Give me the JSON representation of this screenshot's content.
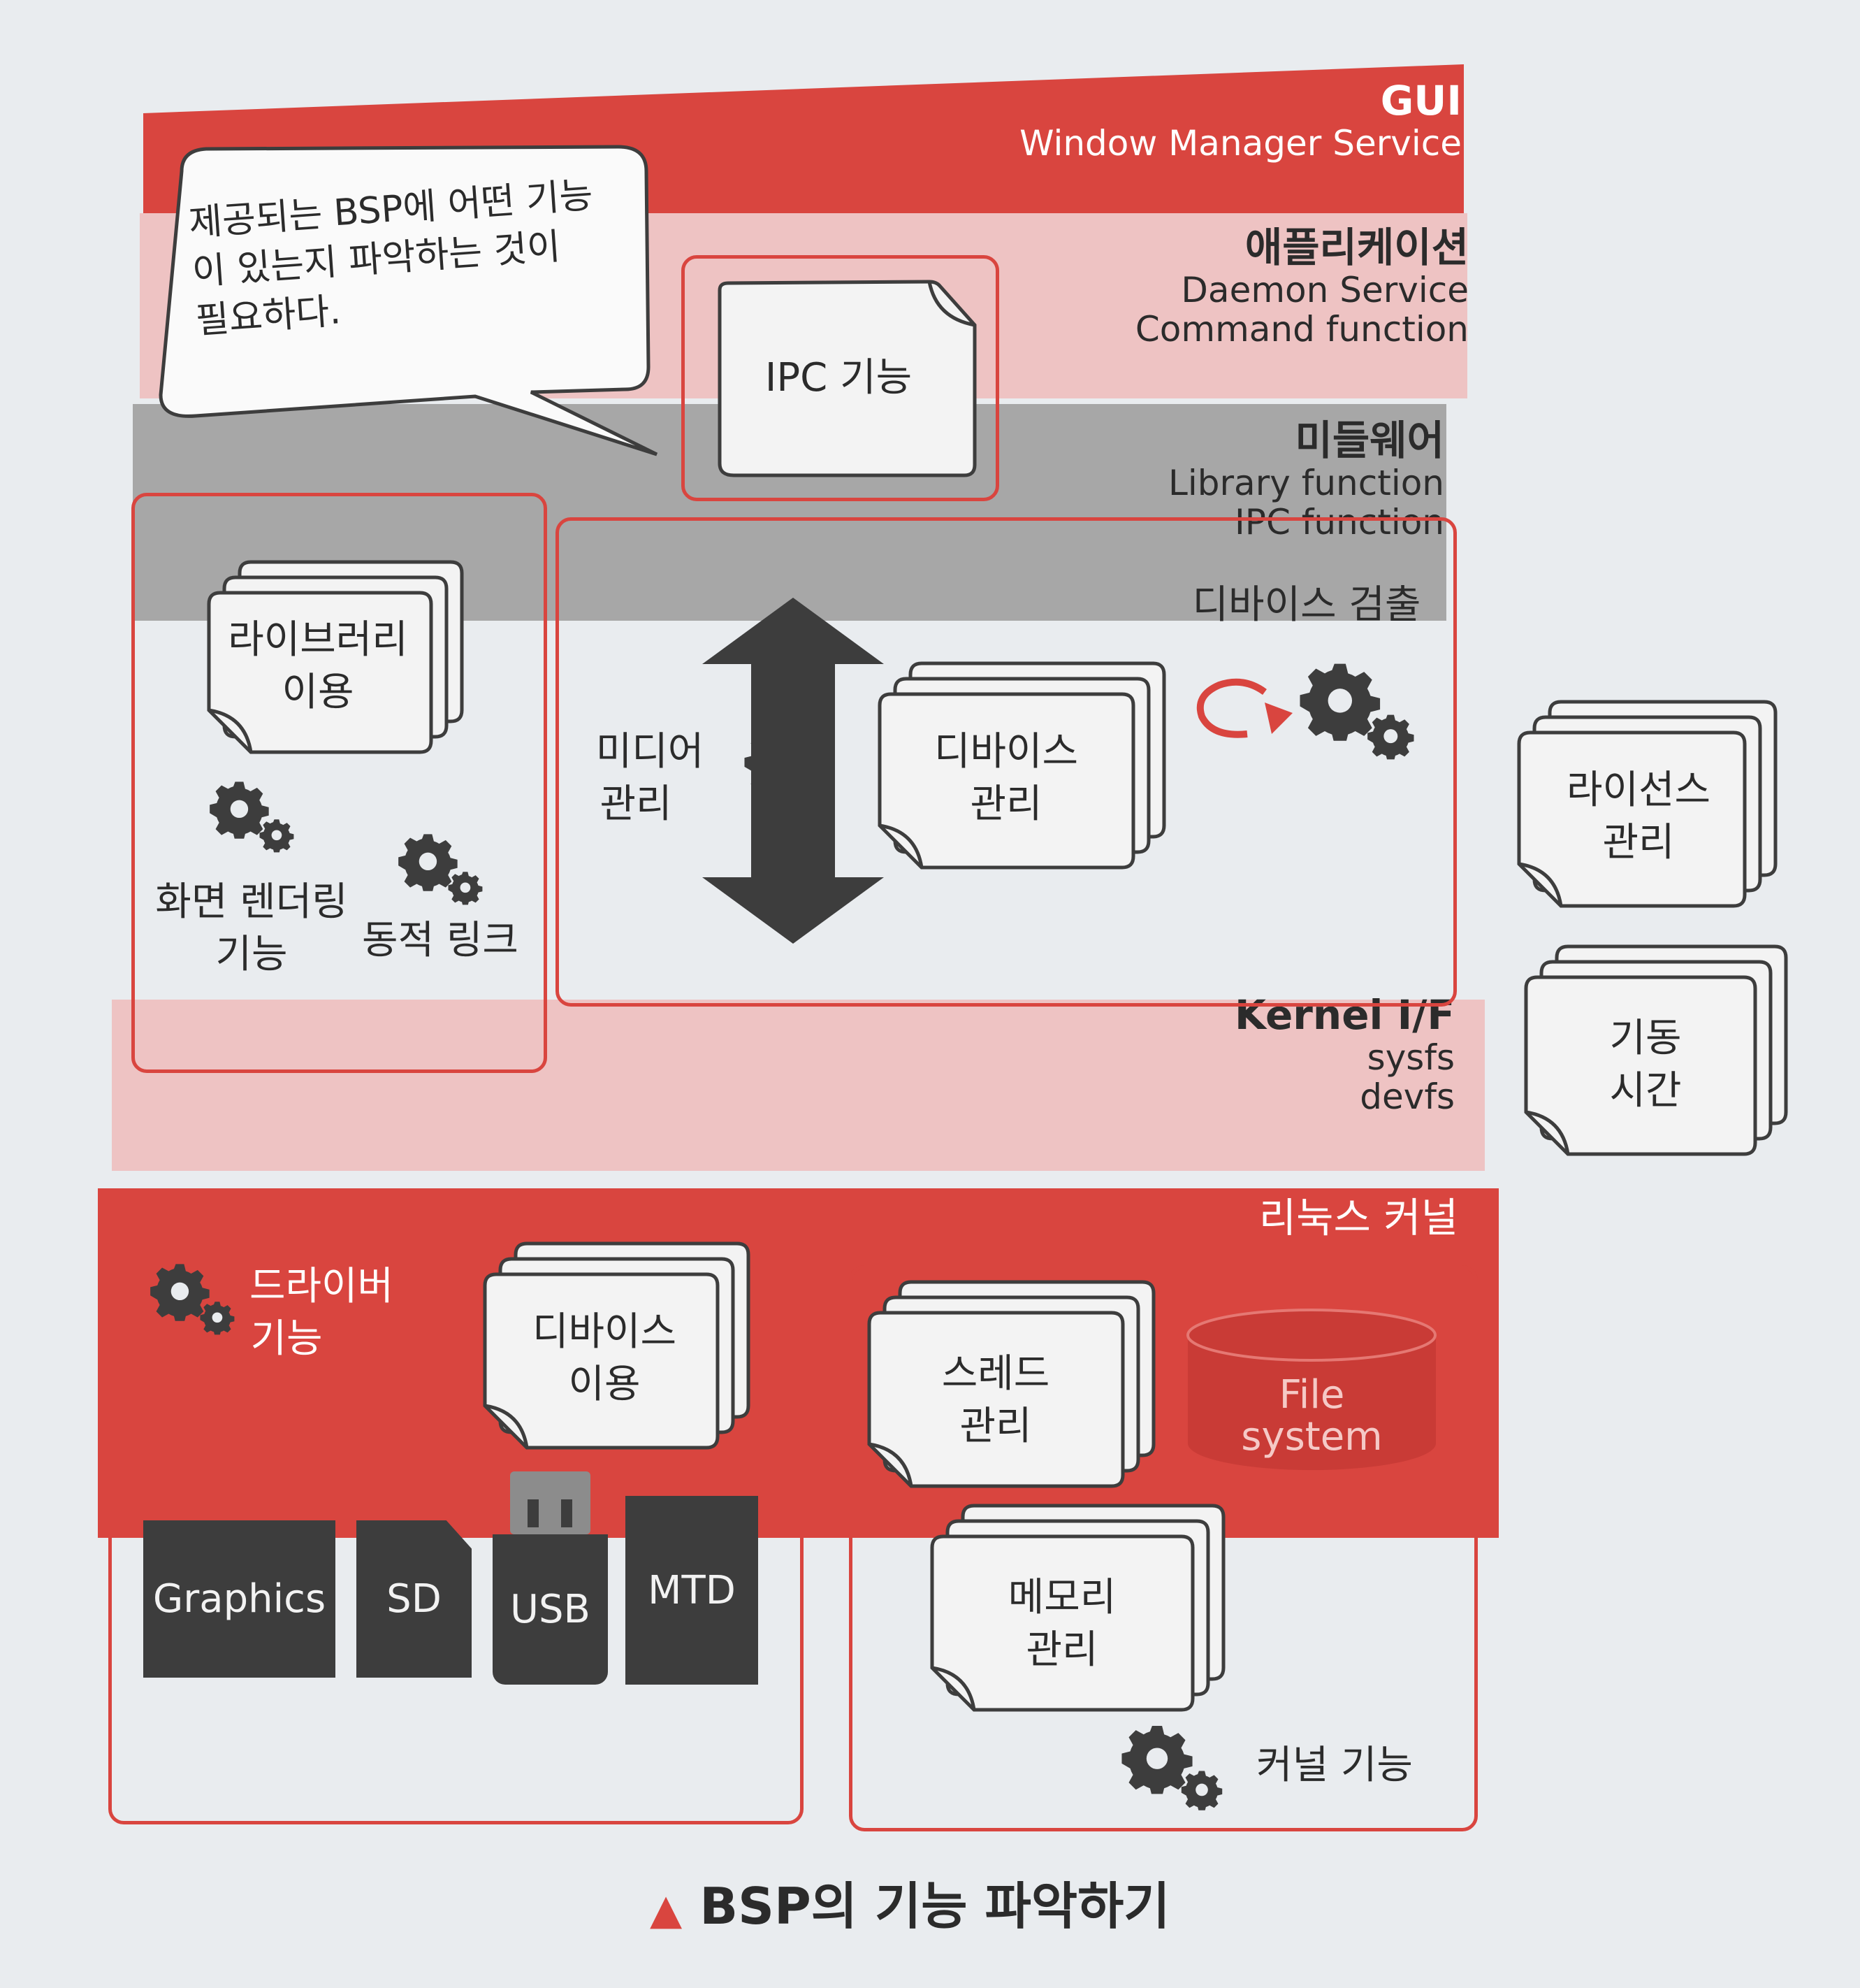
{
  "layers": {
    "gui": {
      "title": "GUI",
      "sub": "Window Manager Service"
    },
    "application": {
      "title": "애플리케이션",
      "sub1": "Daemon Service",
      "sub2": "Command function"
    },
    "middleware": {
      "title": "미들웨어",
      "sub1": "Library function",
      "sub2": "IPC function"
    },
    "kernel_if": {
      "title": "Kernel I/F",
      "sub1": "sysfs",
      "sub2": "devfs"
    },
    "linux_kernel": {
      "title": "리눅스 커널"
    }
  },
  "callout": {
    "line1": "제공되는 BSP에 어떤 기능",
    "line2": "이 있는지 파악하는 것이",
    "line3": "필요하다."
  },
  "docs": {
    "ipc": "IPC 기능",
    "library_1": "라이브러리",
    "library_2": "이용",
    "device_mgmt_1": "디바이스",
    "device_mgmt_2": "관리",
    "license_1": "라이선스",
    "license_2": "관리",
    "boot_1": "기동",
    "boot_2": "시간",
    "device_use_1": "디바이스",
    "device_use_2": "이용",
    "thread_1": "스레드",
    "thread_2": "관리",
    "memory_1": "메모리",
    "memory_2": "관리"
  },
  "labels": {
    "screen_render_1": "화면 렌더링",
    "screen_render_2": "기능",
    "dynamic_link": "동적 링크",
    "media_1": "미디어",
    "media_2": "관리",
    "device_detect": "디바이스 검출",
    "driver_1": "드라이버",
    "driver_2": "기능",
    "kernel_func": "커널 기능",
    "fs_1": "File",
    "fs_2": "system"
  },
  "hardware": [
    "Graphics",
    "SD",
    "USB",
    "MTD"
  ],
  "caption": {
    "marker": "▲",
    "text": "BSP의 기능 파악하기"
  },
  "colors": {
    "red": "#d9453f",
    "pink": "#eec3c3",
    "gray": "#a7a7a7",
    "dark": "#3d3d3d"
  }
}
